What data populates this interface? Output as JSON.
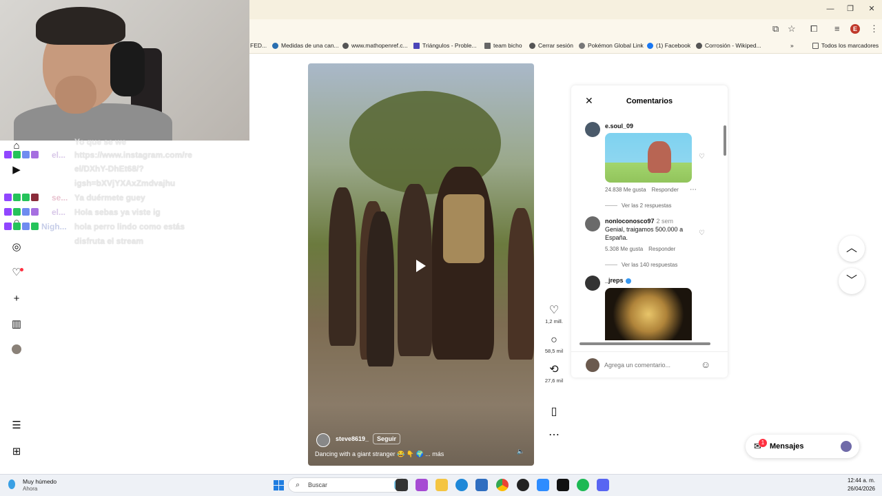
{
  "browser": {
    "bookmarks": [
      {
        "label": "FED..."
      },
      {
        "label": "Medidas de una can..."
      },
      {
        "label": "www.mathopenref.c..."
      },
      {
        "label": "Triángulos - Proble..."
      },
      {
        "label": "team bicho"
      },
      {
        "label": "Cerrar sesión"
      },
      {
        "label": "Pokémon Global Link"
      },
      {
        "label": "(1) Facebook"
      },
      {
        "label": "Corrosión - Wikiped..."
      }
    ],
    "all_bookmarks": "Todos los marcadores",
    "profile_initial": "E"
  },
  "chat": {
    "lines": [
      {
        "user": "el...",
        "user_color": "#d8c7e8",
        "text": "https://www.instagram.com/re"
      },
      {
        "user": "",
        "user_color": "",
        "text": "el/DXhY-DhEt68/?"
      },
      {
        "user": "",
        "user_color": "",
        "text": "igsh=bXVjYXAxZmdvajhu"
      },
      {
        "user": "se...",
        "user_color": "#e8c2cf",
        "text": "Ya duérmete guey"
      },
      {
        "user": "el...",
        "user_color": "#d8c7e8",
        "text": "Hola sebas ya viste ig"
      },
      {
        "user": "Nigh...",
        "user_color": "#c6cde8",
        "text": "hola perro lindo como estás"
      },
      {
        "user": "",
        "user_color": "",
        "text": "disfruta el stream"
      }
    ],
    "top_partial": "Yo que se we"
  },
  "video": {
    "username": "steve8619_",
    "follow_label": "Seguir",
    "caption": "Dancing with a giant stranger",
    "more_label": "... más"
  },
  "actions": {
    "likes": "1,2 mill.",
    "comments": "58,5 mil",
    "reposts": "27,6 mil"
  },
  "comments_panel": {
    "title": "Comentarios",
    "items": [
      {
        "user": "e.soul_09",
        "time": "",
        "text": "",
        "likes": "24.838 Me gusta",
        "reply": "Responder",
        "replies": "Ver las 2 respuestas"
      },
      {
        "user": "nonloconosco97",
        "time": "2 sem",
        "text": "Genial, traigamos 500.000 a España.",
        "likes": "5.308 Me gusta",
        "reply": "Responder",
        "replies": "Ver las 140 respuestas"
      },
      {
        "user": "_jreps",
        "time": "",
        "text": "",
        "likes": "",
        "reply": "",
        "replies": ""
      }
    ],
    "input_placeholder": "Agrega un comentario..."
  },
  "messages": {
    "label": "Mensajes",
    "badge": "1"
  },
  "taskbar": {
    "weather_title": "Muy húmedo",
    "weather_sub": "Ahora",
    "search_label": "Buscar",
    "time": "12:44 a. m.",
    "date": "26/04/2026"
  },
  "colors": {
    "accent": "#3897f0",
    "notification": "#ff3040",
    "chrome_bg": "#f6f0df"
  }
}
